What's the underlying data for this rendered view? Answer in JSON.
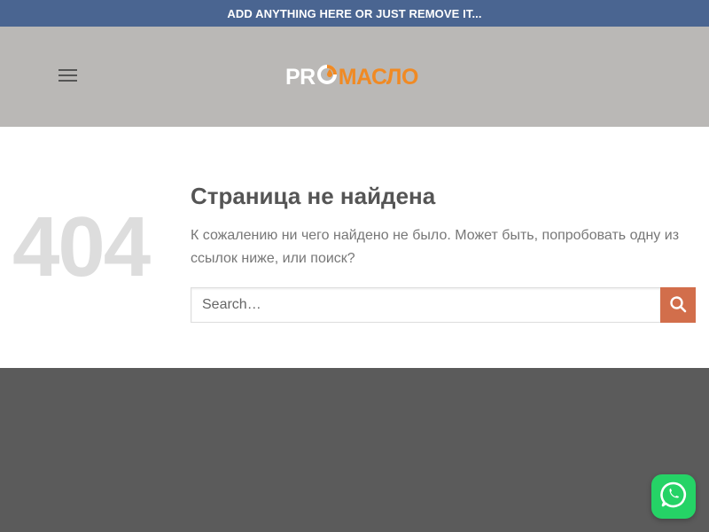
{
  "topbar": {
    "text": "ADD ANYTHING HERE OR JUST REMOVE IT..."
  },
  "header": {
    "menu_icon": "hamburger-menu-icon",
    "logo": {
      "pro": "PR",
      "mark_icon": "drop-ring-logo-icon",
      "maslo": "МАСЛО"
    }
  },
  "main": {
    "code": "404",
    "title": "Страница не найдена",
    "description": "К сожалению ни чего найдено не было. Может быть, попробовать одну из ссылок ниже, или поиск?",
    "search": {
      "placeholder": "Search…",
      "value": "",
      "button_icon": "search-icon"
    }
  },
  "floating": {
    "whatsapp_icon": "whatsapp-icon"
  },
  "colors": {
    "topbar": "#4a6591",
    "header": "#bab8b6",
    "accent": "#d26e4b",
    "logo_orange": "#f08a24",
    "footer": "#5b5b5b",
    "whatsapp": "#25d366"
  }
}
